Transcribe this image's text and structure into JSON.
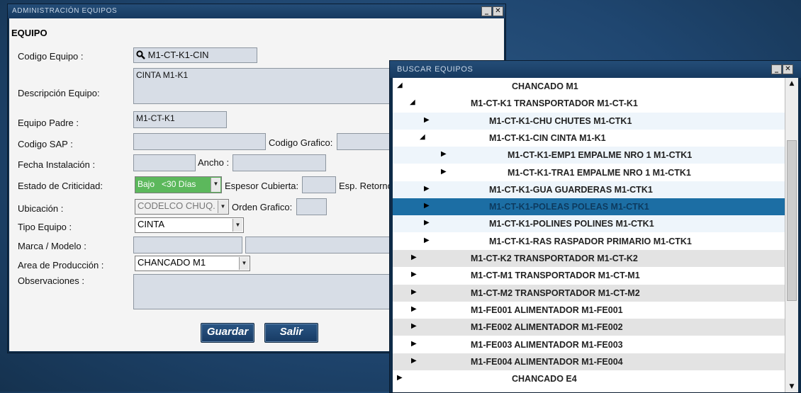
{
  "window_main": {
    "title": "ADMINISTRACIÓN EQUIPOS",
    "section_title": "EQUIPO",
    "labels": {
      "codigo_equipo": "Codigo Equipo :",
      "descripcion": "Descripción Equipo:",
      "equipo_padre": "Equipo Padre :",
      "codigo_sap": "Codigo SAP :",
      "codigo_grafico": "Codigo Grafico:",
      "fecha_instalacion": "Fecha Instalación :",
      "ancho": "Ancho :",
      "estado_criticidad": "Estado de Criticidad:",
      "espesor_cubierta": "Espesor Cubierta:",
      "esp_retorno": "Esp. Retorno",
      "ubicacion": "Ubicación :",
      "orden_grafico": "Orden Grafico:",
      "tipo_equipo": "Tipo Equipo :",
      "marca_modelo": "Marca / Modelo :",
      "area_produccion": "Area de Producción :",
      "observaciones": "Observaciones :"
    },
    "values": {
      "codigo_equipo": "M1-CT-K1-CIN",
      "descripcion": "CINTA M1-K1",
      "equipo_padre": "M1-CT-K1",
      "criticidad": "Bajo   <30 Días",
      "ubicacion": "CODELCO CHUQ.",
      "tipo_equipo": "CINTA",
      "area_produccion": "CHANCADO M1"
    },
    "buttons": {
      "guardar": "Guardar",
      "salir": "Salir"
    },
    "colors": {
      "criticidad_bg": "#5cb85c"
    }
  },
  "window_search": {
    "title": "BUSCAR EQUIPOS",
    "rows": [
      {
        "text": "CHANCADO M1",
        "arrow": "◢"
      },
      {
        "text": "M1-CT-K1 TRANSPORTADOR M1-CT-K1",
        "arrow": "◢"
      },
      {
        "text": "M1-CT-K1-CHU CHUTES M1-CTK1",
        "arrow": "▶"
      },
      {
        "text": "M1-CT-K1-CIN CINTA M1-K1",
        "arrow": "◢"
      },
      {
        "text": "M1-CT-K1-EMP1 EMPALME NRO 1 M1-CTK1",
        "arrow": "▶"
      },
      {
        "text": "M1-CT-K1-TRA1 EMPALME NRO 1 M1-CTK1",
        "arrow": "▶"
      },
      {
        "text": "M1-CT-K1-GUA GUARDERAS M1-CTK1",
        "arrow": "▶"
      },
      {
        "text": "M1-CT-K1-POLEAS POLEAS M1-CTK1",
        "arrow": "▶"
      },
      {
        "text": "M1-CT-K1-POLINES POLINES M1-CTK1",
        "arrow": "▶"
      },
      {
        "text": "M1-CT-K1-RAS RASPADOR PRIMARIO M1-CTK1",
        "arrow": "▶"
      },
      {
        "text": "M1-CT-K2 TRANSPORTADOR M1-CT-K2",
        "arrow": "▶"
      },
      {
        "text": "M1-CT-M1 TRANSPORTADOR M1-CT-M1",
        "arrow": "▶"
      },
      {
        "text": "M1-CT-M2 TRANSPORTADOR M1-CT-M2",
        "arrow": "▶"
      },
      {
        "text": "M1-FE001 ALIMENTADOR M1-FE001",
        "arrow": "▶"
      },
      {
        "text": "M1-FE002 ALIMENTADOR M1-FE002",
        "arrow": "▶"
      },
      {
        "text": "M1-FE003 ALIMENTADOR M1-FE003",
        "arrow": "▶"
      },
      {
        "text": "M1-FE004 ALIMENTADOR M1-FE004",
        "arrow": "▶"
      },
      {
        "text": "CHANCADO E4",
        "arrow": "▶"
      }
    ],
    "selected_color": "#1c6ea4"
  },
  "icons": {
    "minimize": "minimize-icon",
    "close": "close-icon",
    "search": "search-icon"
  }
}
